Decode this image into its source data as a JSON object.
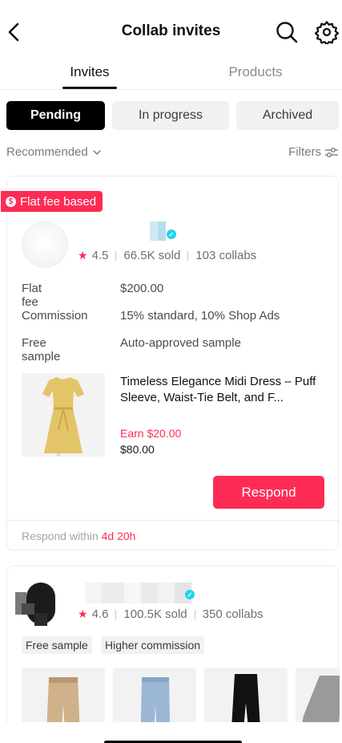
{
  "header": {
    "title": "Collab invites"
  },
  "tabs": [
    {
      "label": "Invites",
      "active": true
    },
    {
      "label": "Products",
      "active": false
    }
  ],
  "status_filters": [
    {
      "label": "Pending",
      "selected": true
    },
    {
      "label": "In progress",
      "selected": false
    },
    {
      "label": "Archived",
      "selected": false
    }
  ],
  "sort": {
    "label": "Recommended"
  },
  "filters": {
    "label": "Filters"
  },
  "invites": [
    {
      "badge": "Flat fee based",
      "rating": "4.5",
      "sold": "66.5K sold",
      "collabs": "103 collabs",
      "terms": [
        {
          "label": "Flat fee",
          "value": "$200.00"
        },
        {
          "label": "Commission",
          "value": "15% standard, 10% Shop Ads"
        },
        {
          "label": "Free sample",
          "value": "Auto-approved sample"
        }
      ],
      "product": {
        "name": "Timeless Elegance Midi Dress – Puff Sleeve, Waist-Tie Belt, and F...",
        "earn": "Earn $20.00",
        "price": "$80.00"
      },
      "respond_label": "Respond",
      "respond_within_label": "Respond within",
      "respond_within_time": "4d 20h"
    },
    {
      "rating": "4.6",
      "sold": "100.5K sold",
      "collabs": "350 collabs",
      "tags": [
        "Free sample",
        "Higher commission"
      ]
    }
  ],
  "colors": {
    "accent": "#fe2c55",
    "verified": "#20d5ec",
    "pill_selected": "#000000"
  }
}
